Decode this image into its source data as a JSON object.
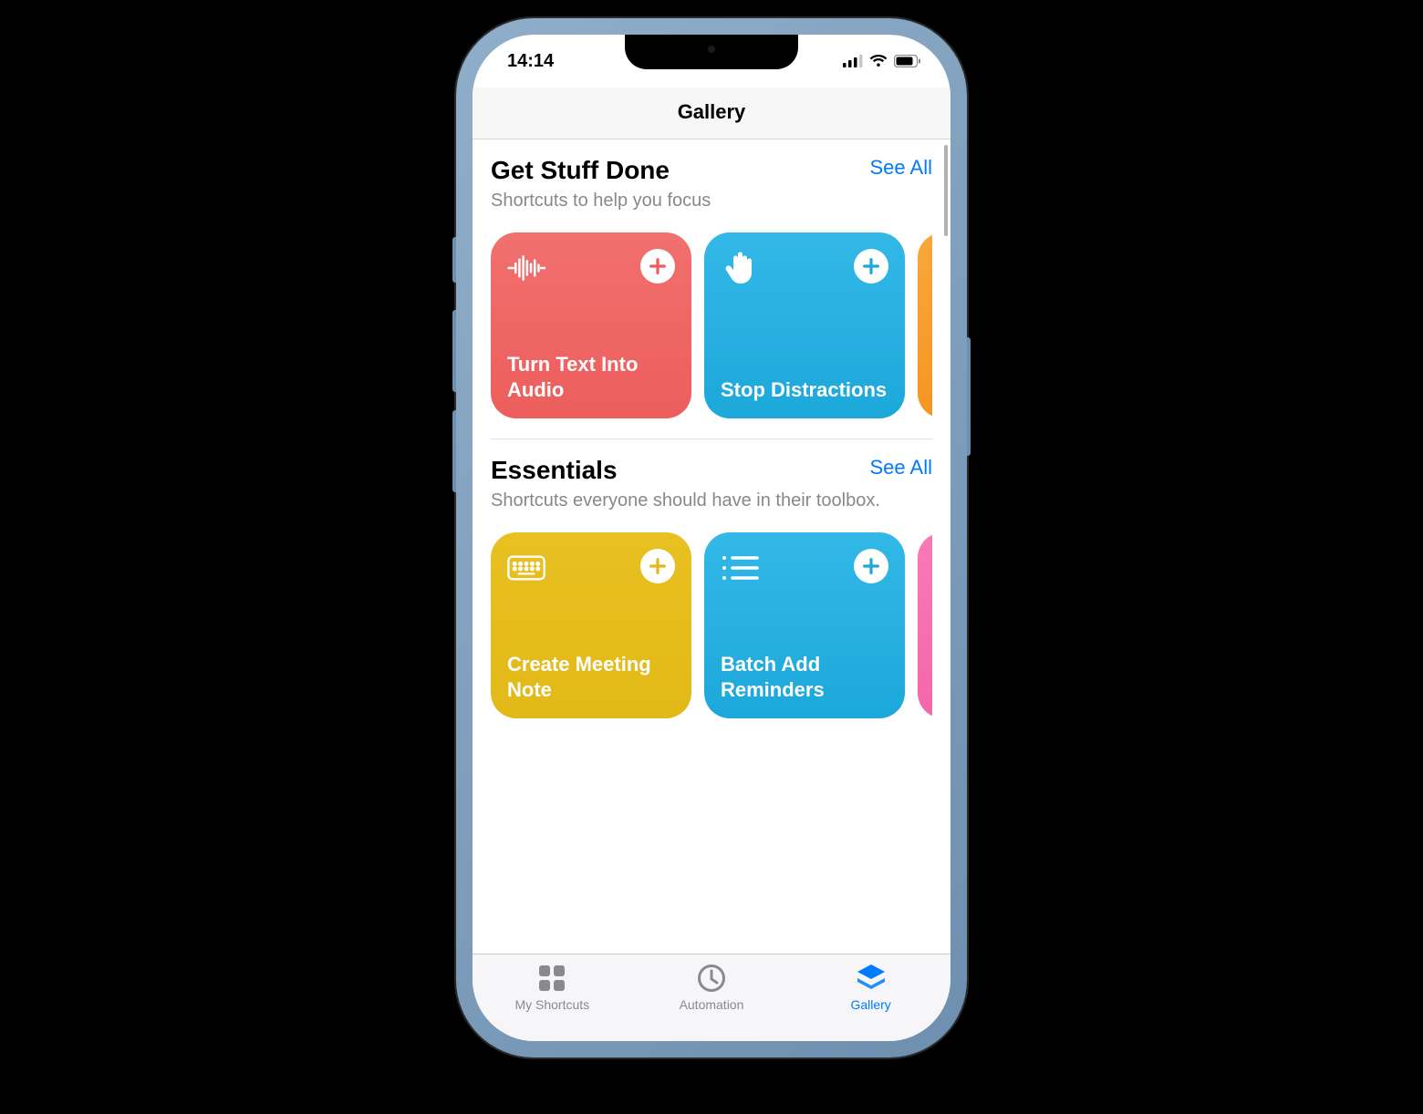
{
  "status": {
    "time": "14:14"
  },
  "nav": {
    "title": "Gallery"
  },
  "sections": [
    {
      "title": "Get Stuff Done",
      "subtitle": "Shortcuts to help you focus",
      "see_all": "See All",
      "cards": [
        {
          "title": "Turn Text Into Audio",
          "color": "red",
          "icon": "waveform",
          "plus_color": "#ec5e5c"
        },
        {
          "title": "Stop Distractions",
          "color": "blue",
          "icon": "hand",
          "plus_color": "#1ca8da"
        },
        {
          "title": "",
          "color": "orange",
          "icon": "",
          "plus_color": "#f69522"
        }
      ]
    },
    {
      "title": "Essentials",
      "subtitle": "Shortcuts everyone should have in their toolbox.",
      "see_all": "See All",
      "cards": [
        {
          "title": "Create Meeting Note",
          "color": "yellow",
          "icon": "keyboard",
          "plus_color": "#e1b918"
        },
        {
          "title": "Batch Add Reminders",
          "color": "blue",
          "icon": "list",
          "plus_color": "#1ca8da"
        },
        {
          "title": "",
          "color": "pink",
          "icon": "",
          "plus_color": "#f566aa"
        }
      ]
    }
  ],
  "tabs": [
    {
      "label": "My Shortcuts",
      "icon": "grid",
      "active": false
    },
    {
      "label": "Automation",
      "icon": "clock",
      "active": false
    },
    {
      "label": "Gallery",
      "icon": "layers",
      "active": true
    }
  ]
}
